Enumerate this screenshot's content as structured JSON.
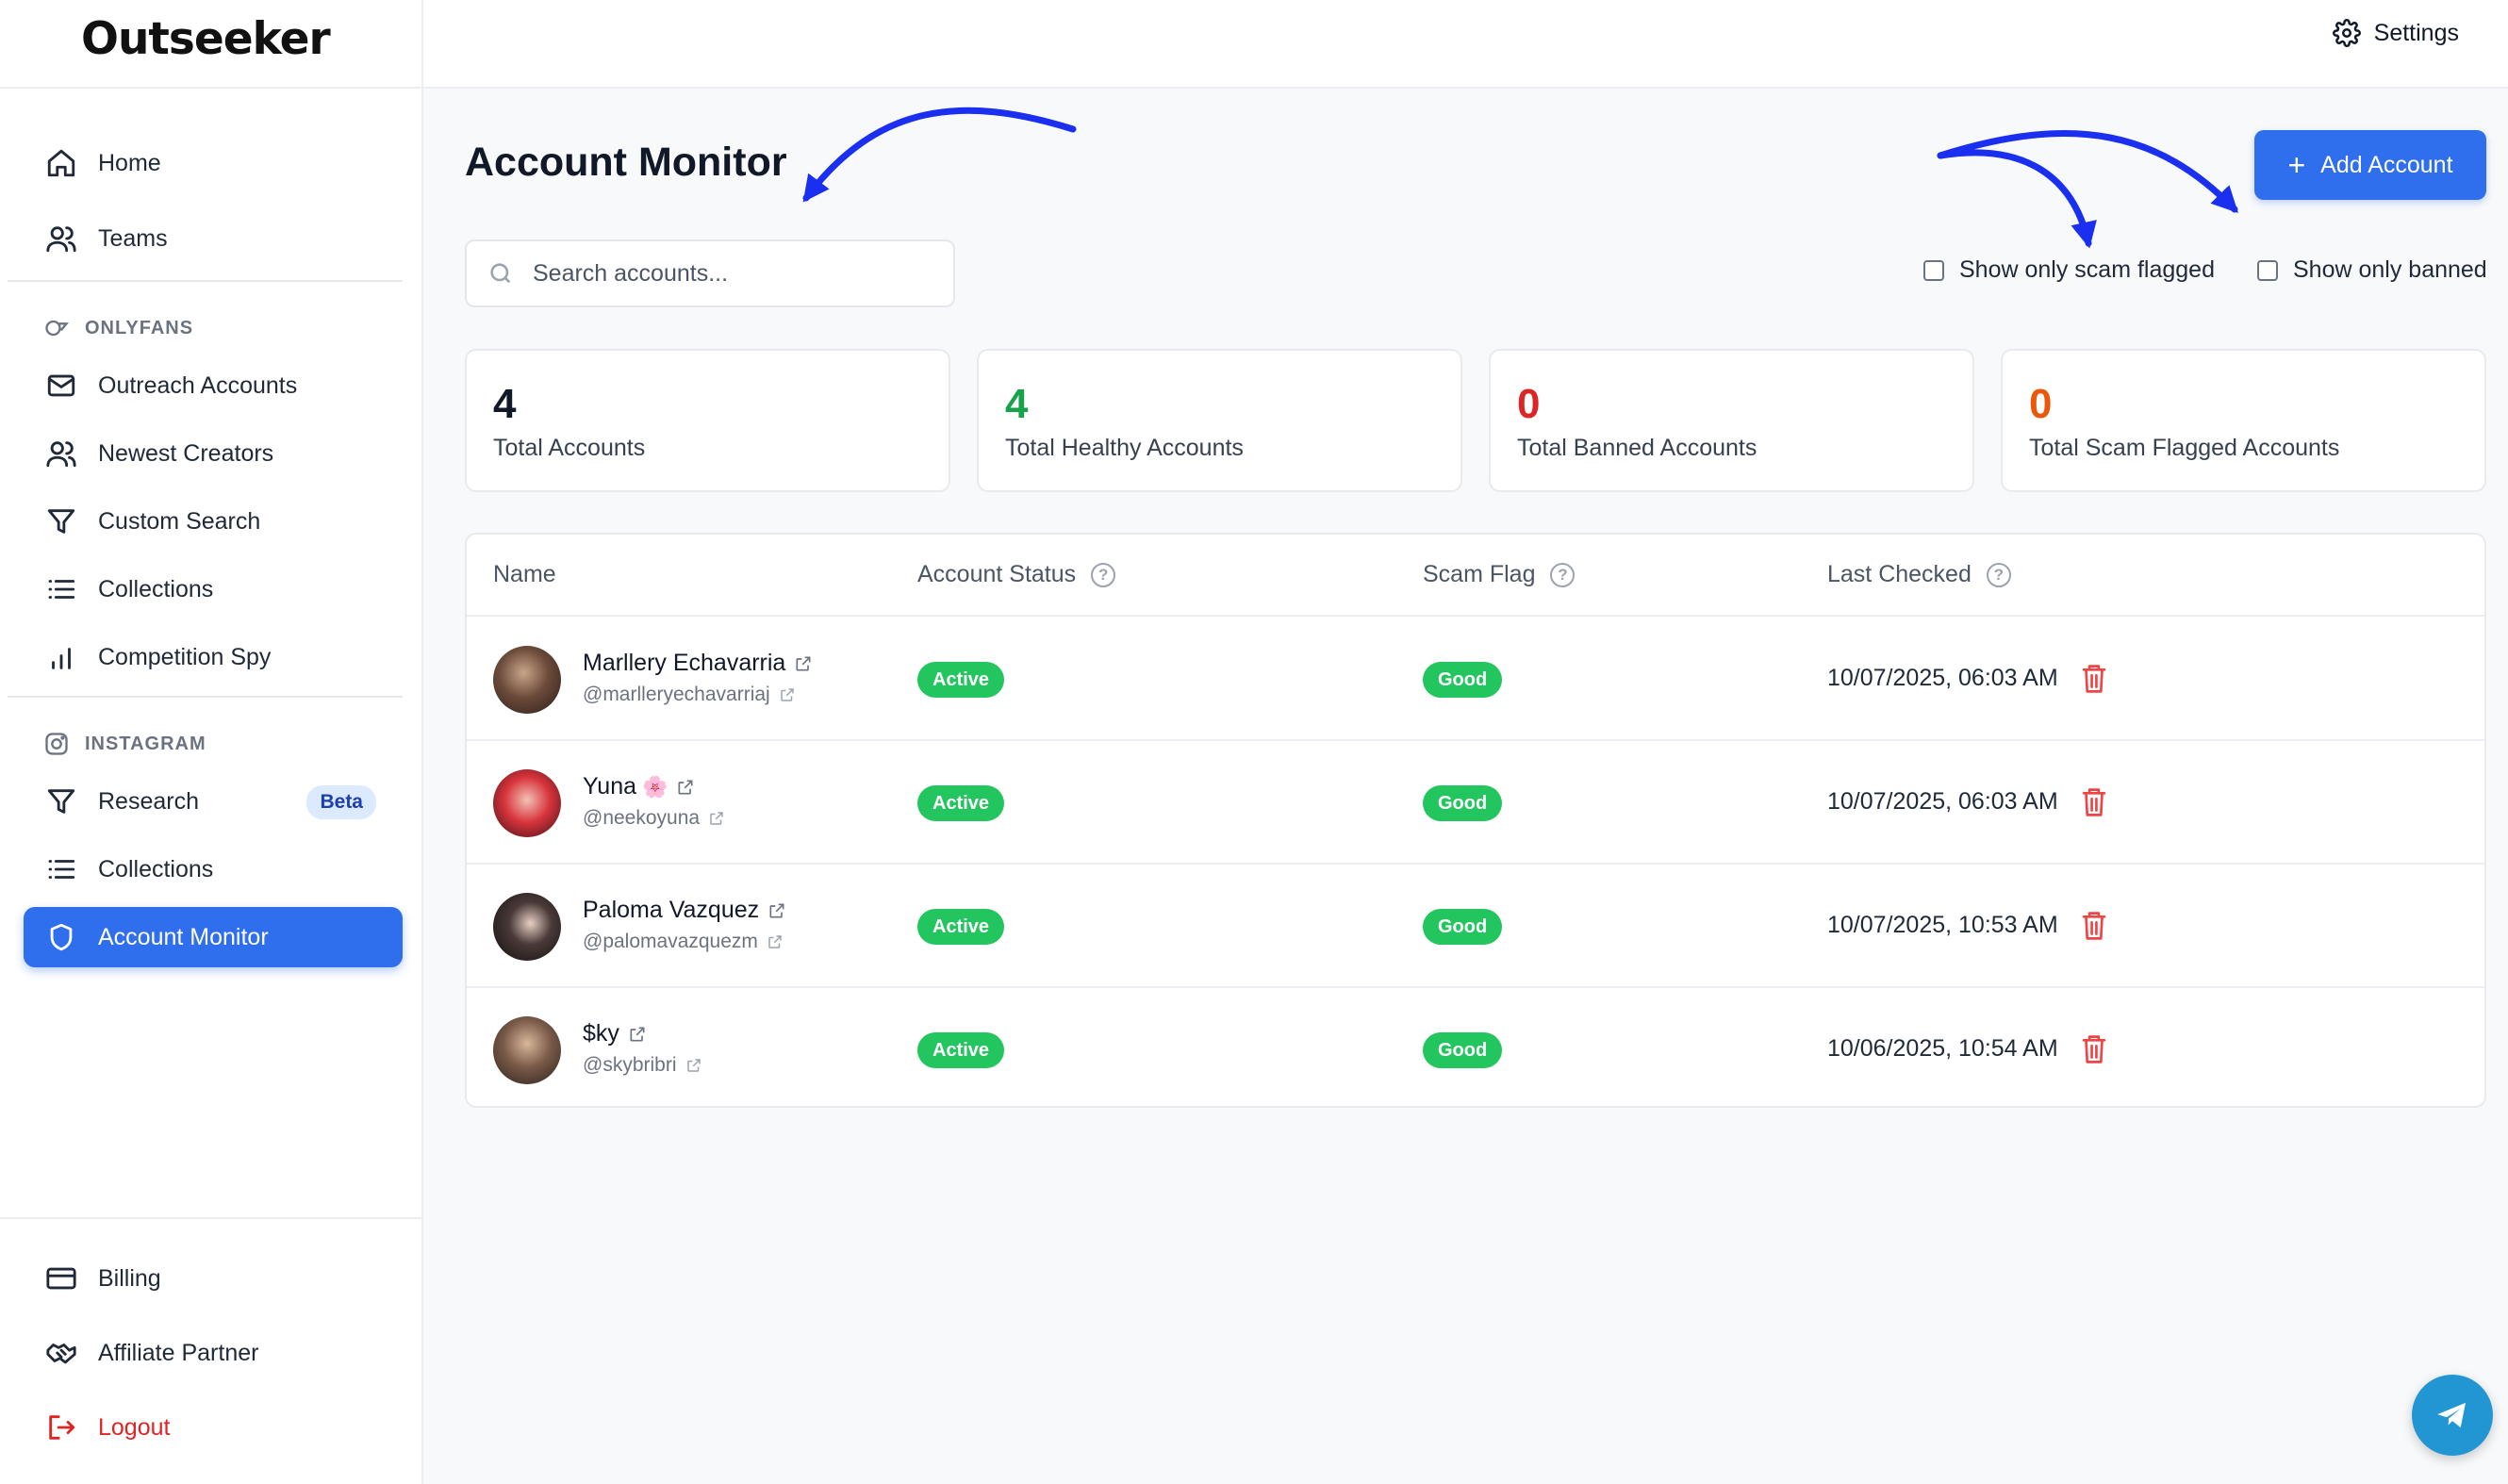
{
  "app": {
    "logo": "Outseeker"
  },
  "topbar": {
    "settings_label": "Settings"
  },
  "sidebar": {
    "top_items": [
      {
        "label": "Home",
        "icon": "home-icon"
      },
      {
        "label": "Teams",
        "icon": "users-icon"
      }
    ],
    "onlyfans": {
      "label": "ONLYFANS",
      "items": [
        {
          "label": "Outreach Accounts",
          "icon": "mail-icon"
        },
        {
          "label": "Newest Creators",
          "icon": "users-icon"
        },
        {
          "label": "Custom Search",
          "icon": "filter-icon"
        },
        {
          "label": "Collections",
          "icon": "list-icon"
        },
        {
          "label": "Competition Spy",
          "icon": "bar-chart-icon"
        }
      ]
    },
    "instagram": {
      "label": "INSTAGRAM",
      "items": [
        {
          "label": "Research",
          "icon": "filter-icon",
          "badge": "Beta"
        },
        {
          "label": "Collections",
          "icon": "list-icon"
        },
        {
          "label": "Account Monitor",
          "icon": "shield-icon",
          "active": true
        }
      ]
    },
    "bottom_items": [
      {
        "label": "Billing",
        "icon": "credit-card-icon"
      },
      {
        "label": "Affiliate Partner",
        "icon": "handshake-icon"
      },
      {
        "label": "Logout",
        "icon": "logout-icon"
      }
    ]
  },
  "main": {
    "title": "Account Monitor",
    "search_placeholder": "Search accounts...",
    "add_button": "Add Account",
    "filters": {
      "scam_flagged": "Show only scam flagged",
      "banned": "Show only banned"
    },
    "stats": [
      {
        "value": "4",
        "label": "Total Accounts",
        "color": "#111827"
      },
      {
        "value": "4",
        "label": "Total Healthy Accounts",
        "color": "#16a34a"
      },
      {
        "value": "0",
        "label": "Total Banned Accounts",
        "color": "#dc2626"
      },
      {
        "value": "0",
        "label": "Total Scam Flagged Accounts",
        "color": "#ea580c"
      }
    ],
    "table": {
      "columns": [
        "Name",
        "Account Status",
        "Scam Flag",
        "Last Checked"
      ],
      "rows": [
        {
          "name": "Marllery Echavarria",
          "emoji": "",
          "handle": "@marlleryechavarriaj",
          "status": "Active",
          "scam_flag": "Good",
          "last_checked": "10/07/2025, 06:03 AM"
        },
        {
          "name": "Yuna",
          "emoji": "🌸",
          "handle": "@neekoyuna",
          "status": "Active",
          "scam_flag": "Good",
          "last_checked": "10/07/2025, 06:03 AM"
        },
        {
          "name": "Paloma Vazquez",
          "emoji": "",
          "handle": "@palomavazquezm",
          "status": "Active",
          "scam_flag": "Good",
          "last_checked": "10/07/2025, 10:53 AM"
        },
        {
          "name": "$ky",
          "emoji": "",
          "handle": "@skybribri",
          "status": "Active",
          "scam_flag": "Good",
          "last_checked": "10/06/2025, 10:54 AM"
        }
      ]
    }
  },
  "colors": {
    "accent": "#2f6fee",
    "status_good": "#22c55e",
    "danger": "#ef4444",
    "annotation_arrow": "#1a2ff0",
    "telegram": "#2196d3"
  }
}
